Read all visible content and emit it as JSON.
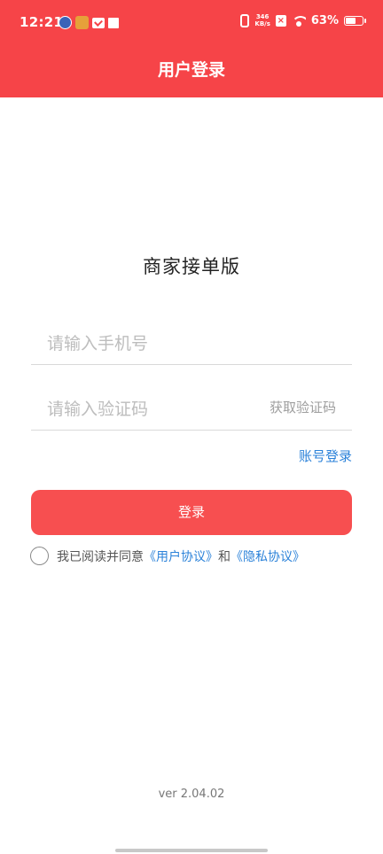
{
  "status_bar": {
    "time": "12:21",
    "net_speed_value": "346",
    "net_speed_unit": "KB/s",
    "battery_percent": "63%",
    "battery_level": 0.63
  },
  "header": {
    "title": "用户登录",
    "bg_color": "#f64448"
  },
  "app_name": "商家接单版",
  "form": {
    "phone_placeholder": "请输入手机号",
    "code_placeholder": "请输入验证码",
    "get_code_label": "获取验证码",
    "account_login_label": "账号登录",
    "login_button_label": "登录"
  },
  "agreement": {
    "prefix": "我已阅读并同意",
    "user_agreement": "《用户协议》",
    "conjunction": "和",
    "privacy_agreement": "《隐私协议》",
    "checked": false
  },
  "version": "ver 2.04.02",
  "colors": {
    "accent": "#f74f50",
    "link": "#2b82d9"
  }
}
